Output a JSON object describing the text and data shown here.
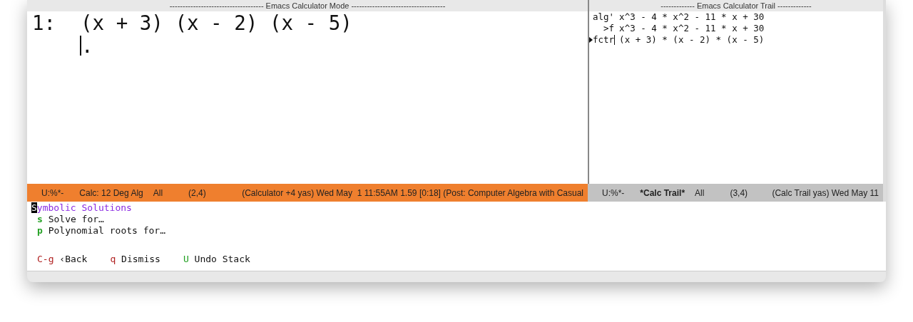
{
  "calc_window": {
    "header": "------------------------------------ Emacs Calculator Mode ------------------------------------",
    "stack": [
      {
        "index": "1:",
        "expr": "(x + 3) (x - 2) (x - 5)"
      }
    ],
    "stack_end": ".",
    "mode_line": {
      "active": true,
      "segments": [
        {
          "text": "U:%*-",
          "bold": false
        },
        {
          "text": "Calc: 12 Deg Alg",
          "bold": false
        },
        {
          "text": "All",
          "bold": false
        },
        {
          "text": "(2,4)",
          "bold": false
        },
        {
          "text": "(Calculator +4 yas) Wed May  1 11:55AM 1.59 [0:18] (Post: Computer Algebra with Casual",
          "bold": false
        }
      ]
    }
  },
  "trail_window": {
    "header": "------------- Emacs Calculator Trail -------------",
    "lines": [
      {
        "tag": "alg'",
        "expr": "x^3 - 4 * x^2 - 11 * x + 30",
        "current": false
      },
      {
        "tag": "  >f",
        "expr": "x^3 - 4 * x^2 - 11 * x + 30",
        "current": false
      },
      {
        "tag": "fctr",
        "expr": "(x + 3) * (x - 2) * (x - 5)",
        "current": true
      }
    ],
    "mode_line": {
      "active": false,
      "segments": [
        {
          "text": "U:%*-",
          "bold": false
        },
        {
          "text": "*Calc Trail*",
          "bold": true
        },
        {
          "text": "All",
          "bold": false
        },
        {
          "text": "(3,4)",
          "bold": false
        },
        {
          "text": "(Calc Trail yas) Wed May 11",
          "bold": false
        }
      ]
    }
  },
  "menu": {
    "title": "Symbolic Solutions",
    "items": [
      {
        "key": "s",
        "label": "Solve for…",
        "color": "#22a022"
      },
      {
        "key": "p",
        "label": "Polynomial roots for…",
        "color": "#22a022"
      }
    ],
    "footer": [
      {
        "key": "C-g",
        "label": "‹Back",
        "color": "#b02020"
      },
      {
        "key": "q",
        "label": "Dismiss",
        "color": "#b02020"
      },
      {
        "key": "U",
        "label": "Undo Stack",
        "color": "#22a022"
      }
    ]
  }
}
